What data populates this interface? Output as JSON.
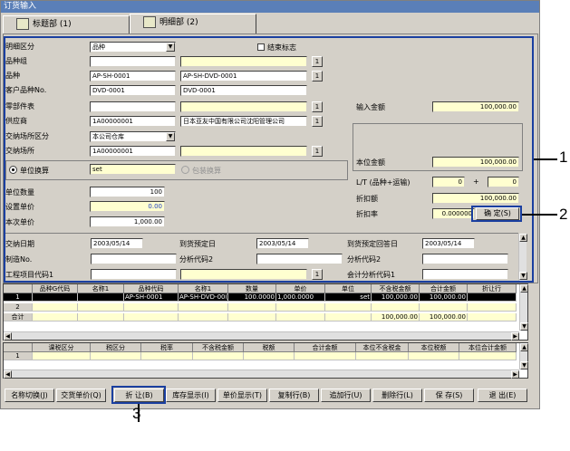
{
  "window": {
    "title": "订货输入"
  },
  "tabs": [
    {
      "label": "标题部 (1)"
    },
    {
      "label": "明细部 (2)"
    }
  ],
  "form": {
    "detail_type_label": "明细区分",
    "detail_type_value": "品种",
    "end_flag_label": "结束标志",
    "product_group_label": "品种组",
    "product_label": "品种",
    "product_value": "AP-SH-0001",
    "product_name": "AP-SH-DVD-0001",
    "customer_code_label": "客户品种No.",
    "customer_code_value": "DVD-0001",
    "customer_code_name": "DVD-0001",
    "parts_label": "零部件表",
    "supplier_label": "供应商",
    "supplier_value": "1A00000001",
    "supplier_name": "日本亚友中国有限公司沈阳管理公司",
    "delivery_type_label": "交纳场所区分",
    "delivery_type_value": "本公司仓库",
    "delivery_place_label": "交纳场所",
    "delivery_place_value": "1A00000001",
    "unit_convert_label": "单位换算",
    "unit_convert_value": "set",
    "package_convert_label": "包装换算",
    "unit_qty_label": "单位数量",
    "unit_qty_value": "100",
    "set_unit_price_label": "设置单价",
    "set_unit_price_value": "0.00",
    "this_unit_price_label": "本次单价",
    "this_unit_price_value": "1,000.00",
    "input_amount_label": "输入金额",
    "input_amount_value": "100,000.00",
    "local_amount_label": "本位金额",
    "local_amount_value": "100,000.00",
    "lt_label": "L/T (品种+运输)",
    "lt_value1": "0",
    "lt_plus": "+",
    "lt_value2": "0",
    "discount_amount_label": "折扣额",
    "discount_amount_value": "100,000.00",
    "discount_rate_label": "折扣率",
    "discount_rate_value": "0.000000",
    "confirm_button": "确  定(S)",
    "order_date_label": "交纳日期",
    "order_date_value": "2003/05/14",
    "arrival_date_label": "到货预定日",
    "arrival_date_value": "2003/05/14",
    "arrival_reply_label": "到货预定回答日",
    "arrival_reply_value": "2003/05/14",
    "manufacture_no_label": "制造No.",
    "analysis2_label": "分析代码2",
    "analysis3_label": "分析代码2",
    "project_code_label": "工程项目代码1",
    "accounting_code_label": "会计分析代码1",
    "button_one": "1"
  },
  "grid1": {
    "headers": [
      "",
      "品种G代码",
      "名称1",
      "品种代码",
      "名称1",
      "数量",
      "单价",
      "单位",
      "不含税金额",
      "合计金额",
      "折让行"
    ],
    "rows": [
      {
        "no": "1",
        "cells": [
          "",
          "",
          "AP-SH-0001",
          "AP-SH-DVD-00(",
          "100.0000",
          "1,000.0000",
          "set",
          "100,000.00",
          "100,000.00",
          ""
        ]
      },
      {
        "no": "2",
        "cells": [
          "",
          "",
          "",
          "",
          "",
          "",
          "",
          "",
          "",
          ""
        ]
      }
    ],
    "total_label": "合计",
    "total_amount": "100,000.00",
    "total_sum": "100,000.00"
  },
  "grid2": {
    "headers": [
      "",
      "课税区分",
      "税区分",
      "税率",
      "不含税金额",
      "税额",
      "合计金额",
      "本位不含税金",
      "本位税额",
      "本位合计金额"
    ],
    "rows": [
      {
        "no": "1"
      }
    ]
  },
  "buttons": [
    "名称切换(J)",
    "交货单价(Q)",
    "折  让(B)",
    "库存显示(I)",
    "单价显示(T)",
    "复制行(B)",
    "追加行(U)",
    "删除行(L)",
    "保  存(S)",
    "退  出(E)"
  ],
  "callouts": [
    "1",
    "2",
    "3"
  ]
}
